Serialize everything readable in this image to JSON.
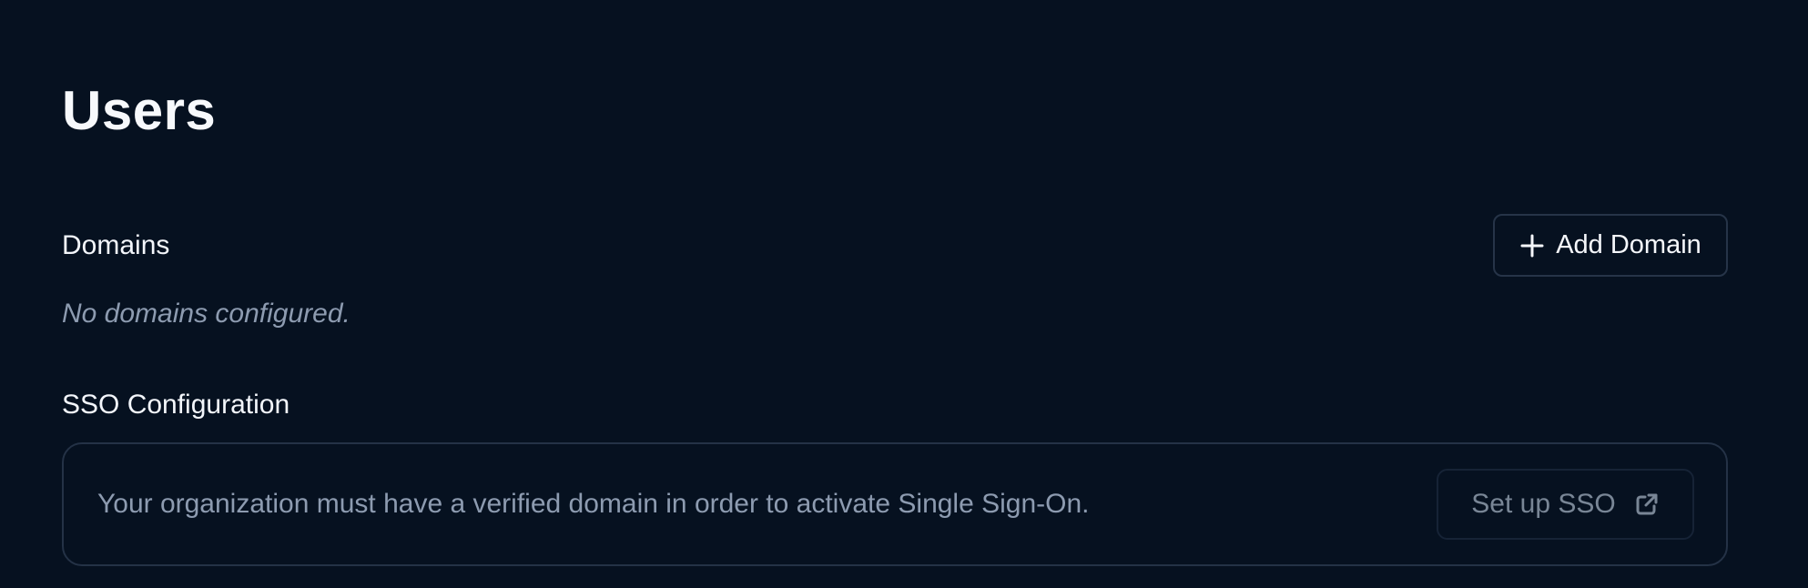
{
  "page": {
    "title": "Users"
  },
  "domains": {
    "title": "Domains",
    "add_button_label": "Add Domain",
    "add_button_icon": "plus-icon",
    "empty_message": "No domains configured."
  },
  "sso": {
    "title": "SSO Configuration",
    "message": "Your organization must have a verified domain in order to activate Single Sign-On.",
    "button_label": "Set up SSO",
    "button_icon": "external-link-icon",
    "button_state": "disabled"
  },
  "colors": {
    "background": "#061120",
    "primary_text": "#f3f6fb",
    "muted_text": "#8d9bb0",
    "border": "#243246"
  }
}
